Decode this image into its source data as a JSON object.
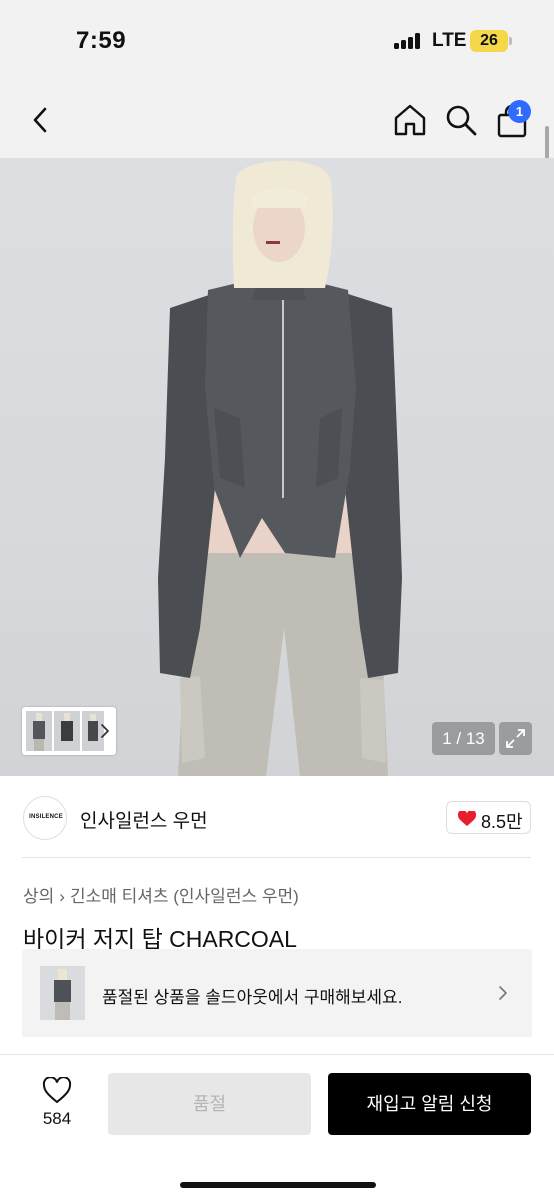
{
  "status_bar": {
    "time": "7:59",
    "network": "LTE",
    "battery": "26"
  },
  "header": {
    "cart_count": "1"
  },
  "gallery": {
    "counter": "1 / 13"
  },
  "brand": {
    "logo_text": "INSILENCE",
    "name": "인사일런스 우먼",
    "likes": "8.5만"
  },
  "breadcrumb": {
    "category": "상의",
    "subcategory": "긴소매 티셔츠 (인사일런스 우먼)"
  },
  "product": {
    "title": "바이커 저지 탑 CHARCOAL"
  },
  "soldout_banner": {
    "text": "품절된 상품을 솔드아웃에서 구매해보세요."
  },
  "bottom_bar": {
    "wish_count": "584",
    "soldout_label": "품절",
    "restock_label": "재입고 알림 신청"
  },
  "colors": {
    "accent_blue": "#2f6bff",
    "heart_red": "#e8202e",
    "black": "#000000"
  }
}
